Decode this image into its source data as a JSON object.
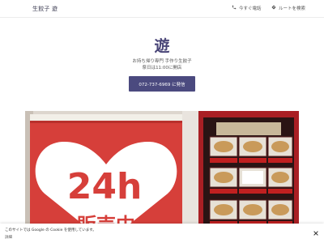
{
  "header": {
    "site_title": "生餃子 遊",
    "call_label": "今すぐ電話",
    "route_label": "ルートを検索",
    "call_icon": "phone-icon",
    "route_icon": "directions-icon"
  },
  "hero": {
    "title": "遊",
    "subtitle_line1": "お持ち帰り専門 手作り生餃子",
    "subtitle_line2": "祭日は11:00に開店",
    "phone_button_label": "072-737-6969 に発信"
  },
  "photo": {
    "banner_number": "24h",
    "banner_text": "販売中"
  },
  "cookie_banner": {
    "text": "このサイトでは Google の Cookie を使用しています。",
    "link": "詳細",
    "close_icon": "close-icon"
  },
  "colors": {
    "accent": "#4b4a7f",
    "banner_red": "#d63f3a",
    "machine_frame": "#a91f24"
  }
}
